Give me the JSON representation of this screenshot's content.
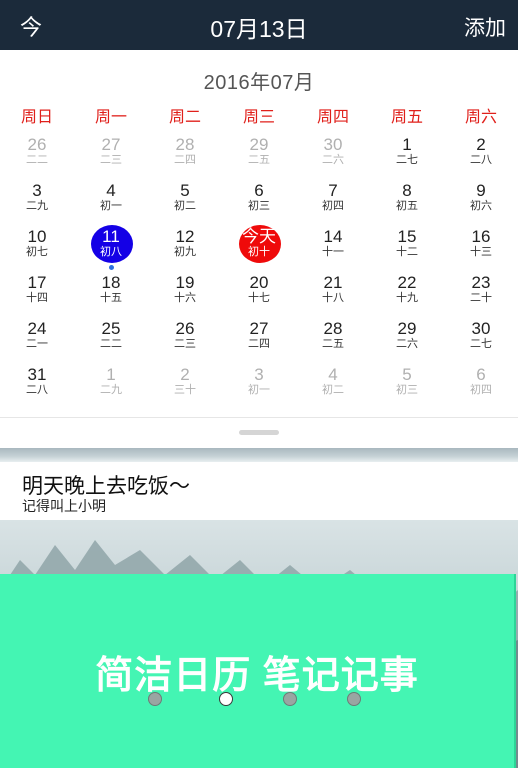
{
  "header": {
    "today_button": "今",
    "date_title": "07月13日",
    "add_button": "添加"
  },
  "calendar": {
    "month_title": "2016年07月",
    "weekdays": [
      "周日",
      "周一",
      "周二",
      "周三",
      "周四",
      "周五",
      "周六"
    ],
    "weeks": [
      [
        {
          "d": "26",
          "l": "二二",
          "other": true
        },
        {
          "d": "27",
          "l": "二三",
          "other": true
        },
        {
          "d": "28",
          "l": "二四",
          "other": true
        },
        {
          "d": "29",
          "l": "二五",
          "other": true
        },
        {
          "d": "30",
          "l": "二六",
          "other": true
        },
        {
          "d": "1",
          "l": "二七"
        },
        {
          "d": "2",
          "l": "二八"
        }
      ],
      [
        {
          "d": "3",
          "l": "二九"
        },
        {
          "d": "4",
          "l": "初一"
        },
        {
          "d": "5",
          "l": "初二"
        },
        {
          "d": "6",
          "l": "初三"
        },
        {
          "d": "7",
          "l": "初四"
        },
        {
          "d": "8",
          "l": "初五"
        },
        {
          "d": "9",
          "l": "初六"
        }
      ],
      [
        {
          "d": "10",
          "l": "初七"
        },
        {
          "d": "11",
          "l": "初八",
          "selected": true,
          "has_event": true
        },
        {
          "d": "12",
          "l": "初九"
        },
        {
          "d": "今天",
          "l": "初十",
          "today": true
        },
        {
          "d": "14",
          "l": "十一"
        },
        {
          "d": "15",
          "l": "十二"
        },
        {
          "d": "16",
          "l": "十三"
        }
      ],
      [
        {
          "d": "17",
          "l": "十四"
        },
        {
          "d": "18",
          "l": "十五"
        },
        {
          "d": "19",
          "l": "十六"
        },
        {
          "d": "20",
          "l": "十七"
        },
        {
          "d": "21",
          "l": "十八"
        },
        {
          "d": "22",
          "l": "十九"
        },
        {
          "d": "23",
          "l": "二十"
        }
      ],
      [
        {
          "d": "24",
          "l": "二一"
        },
        {
          "d": "25",
          "l": "二二"
        },
        {
          "d": "26",
          "l": "二三"
        },
        {
          "d": "27",
          "l": "二四"
        },
        {
          "d": "28",
          "l": "二五"
        },
        {
          "d": "29",
          "l": "二六"
        },
        {
          "d": "30",
          "l": "二七"
        }
      ],
      [
        {
          "d": "31",
          "l": "二八"
        },
        {
          "d": "1",
          "l": "二九",
          "other": true
        },
        {
          "d": "2",
          "l": "三十",
          "other": true
        },
        {
          "d": "3",
          "l": "初一",
          "other": true
        },
        {
          "d": "4",
          "l": "初二",
          "other": true
        },
        {
          "d": "5",
          "l": "初三",
          "other": true
        },
        {
          "d": "6",
          "l": "初四",
          "other": true
        }
      ]
    ]
  },
  "note": {
    "title": "明天晚上去吃饭～",
    "subtitle": "记得叫上小明"
  },
  "banner": {
    "text": "简洁日历  笔记记事",
    "page_count": 4,
    "active_index": 1
  },
  "colors": {
    "header_bg": "#1b2a3a",
    "weekday_red": "#e0201b",
    "selected_blue": "#1400e6",
    "today_red": "#ef0a0a",
    "banner_green": "#44f5b3"
  }
}
